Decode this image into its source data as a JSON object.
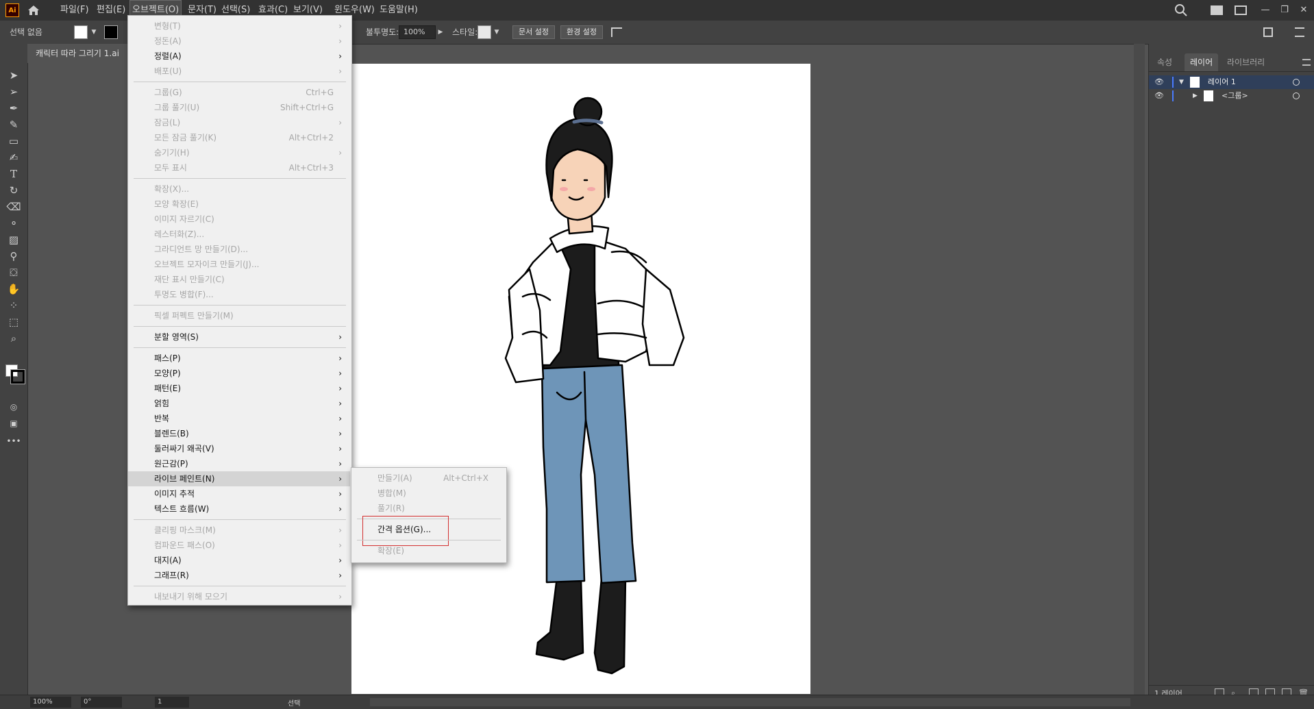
{
  "app": {
    "logo_text": "Ai"
  },
  "menubar": {
    "items": [
      "파일(F)",
      "편집(E)",
      "오브젝트(O)",
      "문자(T)",
      "선택(S)",
      "효과(C)",
      "보기(V)",
      "윈도우(W)",
      "도움말(H)"
    ],
    "active": "오브젝트(O)",
    "window_controls": [
      "—",
      "❐",
      "✕"
    ]
  },
  "controlbar": {
    "selection_label": "선택 없음",
    "opacity_label": "불투명도:",
    "opacity_value": "100%",
    "style_label": "스타일:",
    "doc_setup_button": "문서 설정",
    "preferences_button": "환경 설정"
  },
  "document": {
    "tab_title": "캐릭터 따라 그리기 1.ai"
  },
  "object_menu": {
    "items": [
      {
        "label": "변형(T)",
        "shortcut": "",
        "submenu": true,
        "enabled": false
      },
      {
        "label": "정돈(A)",
        "shortcut": "",
        "submenu": true,
        "enabled": false
      },
      {
        "label": "정렬(A)",
        "shortcut": "",
        "submenu": true,
        "enabled": true
      },
      {
        "label": "배포(U)",
        "shortcut": "",
        "submenu": true,
        "enabled": false
      },
      {
        "sep": true
      },
      {
        "label": "그룹(G)",
        "shortcut": "Ctrl+G",
        "submenu": false,
        "enabled": false
      },
      {
        "label": "그룹 풀기(U)",
        "shortcut": "Shift+Ctrl+G",
        "submenu": false,
        "enabled": false
      },
      {
        "label": "잠금(L)",
        "shortcut": "",
        "submenu": true,
        "enabled": false
      },
      {
        "label": "모든 잠금 풀기(K)",
        "shortcut": "Alt+Ctrl+2",
        "submenu": false,
        "enabled": false
      },
      {
        "label": "숨기기(H)",
        "shortcut": "",
        "submenu": true,
        "enabled": false
      },
      {
        "label": "모두 표시",
        "shortcut": "Alt+Ctrl+3",
        "submenu": false,
        "enabled": false
      },
      {
        "sep": true
      },
      {
        "label": "확장(X)...",
        "shortcut": "",
        "submenu": false,
        "enabled": false
      },
      {
        "label": "모양 확장(E)",
        "shortcut": "",
        "submenu": false,
        "enabled": false
      },
      {
        "label": "이미지 자르기(C)",
        "shortcut": "",
        "submenu": false,
        "enabled": false
      },
      {
        "label": "레스터화(Z)...",
        "shortcut": "",
        "submenu": false,
        "enabled": false
      },
      {
        "label": "그라디언트 망 만들기(D)...",
        "shortcut": "",
        "submenu": false,
        "enabled": false
      },
      {
        "label": "오브젝트 모자이크 만들기(J)...",
        "shortcut": "",
        "submenu": false,
        "enabled": false
      },
      {
        "label": "재단 표시 만들기(C)",
        "shortcut": "",
        "submenu": false,
        "enabled": false
      },
      {
        "label": "투명도 병합(F)...",
        "shortcut": "",
        "submenu": false,
        "enabled": false
      },
      {
        "sep": true
      },
      {
        "label": "픽셀 퍼펙트 만들기(M)",
        "shortcut": "",
        "submenu": false,
        "enabled": false
      },
      {
        "sep": true
      },
      {
        "label": "분할 영역(S)",
        "shortcut": "",
        "submenu": true,
        "enabled": true
      },
      {
        "sep": true
      },
      {
        "label": "패스(P)",
        "shortcut": "",
        "submenu": true,
        "enabled": true
      },
      {
        "label": "모양(P)",
        "shortcut": "",
        "submenu": true,
        "enabled": true
      },
      {
        "label": "패턴(E)",
        "shortcut": "",
        "submenu": true,
        "enabled": true
      },
      {
        "label": "얽힘",
        "shortcut": "",
        "submenu": true,
        "enabled": true
      },
      {
        "label": "반복",
        "shortcut": "",
        "submenu": true,
        "enabled": true
      },
      {
        "label": "블렌드(B)",
        "shortcut": "",
        "submenu": true,
        "enabled": true
      },
      {
        "label": "둘러싸기 왜곡(V)",
        "shortcut": "",
        "submenu": true,
        "enabled": true
      },
      {
        "label": "원근감(P)",
        "shortcut": "",
        "submenu": true,
        "enabled": true
      },
      {
        "label": "라이브 페인트(N)",
        "shortcut": "",
        "submenu": true,
        "enabled": true,
        "hover": true
      },
      {
        "label": "이미지 추적",
        "shortcut": "",
        "submenu": true,
        "enabled": true
      },
      {
        "label": "텍스트 흐름(W)",
        "shortcut": "",
        "submenu": true,
        "enabled": true
      },
      {
        "sep": true
      },
      {
        "label": "클리핑 마스크(M)",
        "shortcut": "",
        "submenu": true,
        "enabled": false
      },
      {
        "label": "컴파운드 패스(O)",
        "shortcut": "",
        "submenu": true,
        "enabled": false
      },
      {
        "label": "대지(A)",
        "shortcut": "",
        "submenu": true,
        "enabled": true
      },
      {
        "label": "그래프(R)",
        "shortcut": "",
        "submenu": true,
        "enabled": true
      },
      {
        "sep": true
      },
      {
        "label": "내보내기 위해 모으기",
        "shortcut": "",
        "submenu": true,
        "enabled": false
      }
    ]
  },
  "livepaint_submenu": {
    "items": [
      {
        "label": "만들기(A)",
        "shortcut": "Alt+Ctrl+X",
        "enabled": false
      },
      {
        "label": "병합(M)",
        "shortcut": "",
        "enabled": false
      },
      {
        "label": "풀기(R)",
        "shortcut": "",
        "enabled": false
      },
      {
        "sep": true
      },
      {
        "label": "간격 옵션(G)...",
        "shortcut": "",
        "enabled": true,
        "highlighted": true
      },
      {
        "sep": true
      },
      {
        "label": "확장(E)",
        "shortcut": "",
        "enabled": false
      }
    ]
  },
  "layers_panel": {
    "tabs": [
      "속성",
      "레이어",
      "라이브러리"
    ],
    "active_tab": "레이어",
    "rows": [
      {
        "name": "레이어 1",
        "expanded": true
      },
      {
        "name": "<그룹>",
        "expanded": false
      }
    ],
    "footer_count": "1 레이어"
  },
  "statusbar": {
    "zoom": "100%",
    "rotation": "0°",
    "artboard_num": "1",
    "tool_name": "선택"
  },
  "colors": {
    "highlight_box": "#d32f2f",
    "jeans": "#6e95b8"
  }
}
